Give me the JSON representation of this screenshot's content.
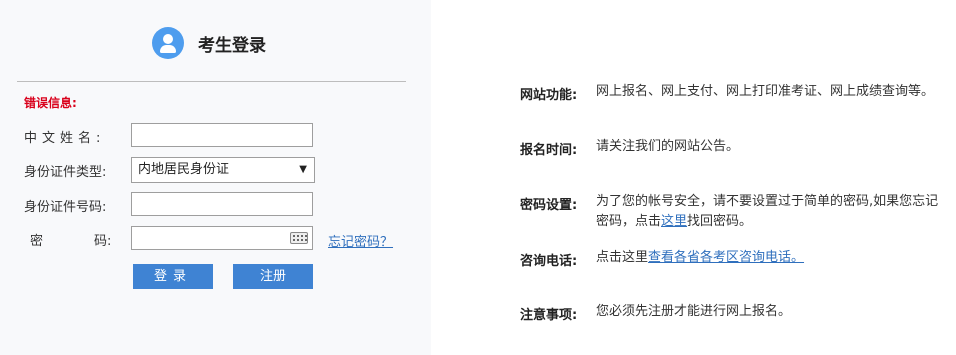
{
  "login": {
    "title": "考生登录",
    "error_label": "错误信息:",
    "fields": {
      "name_label": "中文姓名:",
      "id_type_label": "身份证件类型:",
      "id_type_value": "内地居民身份证",
      "id_number_label": "身份证件号码:",
      "password_label_part1": "密",
      "password_label_part2": "码:",
      "forgot_link": "忘记密码？"
    },
    "buttons": {
      "login": "登录",
      "register": "注册"
    }
  },
  "info": {
    "site_function": {
      "label": "网站功能:",
      "text": "网上报名、网上支付、网上打印准考证、网上成绩查询等。"
    },
    "reg_time": {
      "label": "报名时间:",
      "text": "请关注我们的网站公告。"
    },
    "password_setting": {
      "label": "密码设置:",
      "text_before": "为了您的帐号安全，请不要设置过于简单的密码,如果您忘记密码，点击",
      "link": "这里",
      "text_after": "找回密码。"
    },
    "consult_phone": {
      "label": "咨询电话:",
      "text_before": "点击这里",
      "link": "查看各省各考区咨询电话。"
    },
    "notice": {
      "label": "注意事项:",
      "text": "您必须先注册才能进行网上报名。"
    }
  }
}
